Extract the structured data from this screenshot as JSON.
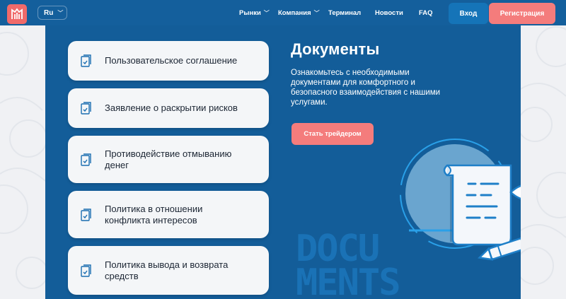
{
  "header": {
    "lang": "Ru",
    "nav": [
      {
        "label": "Рынки",
        "dropdown": true
      },
      {
        "label": "Компания",
        "dropdown": true
      },
      {
        "label": "Терминал",
        "dropdown": false
      },
      {
        "label": "Новости",
        "dropdown": false
      },
      {
        "label": "FAQ",
        "dropdown": false
      }
    ],
    "login": "Вход",
    "register": "Регистрация"
  },
  "documents": [
    {
      "label": "Пользовательское соглашение"
    },
    {
      "label": "Заявление о раскрытии рисков"
    },
    {
      "label": "Противодействие отмыванию денег"
    },
    {
      "label": "Политика в отношении конфликта интересов"
    },
    {
      "label": "Политика вывода и возврата средств"
    }
  ],
  "hero": {
    "title": "Документы",
    "description": "Ознакомьтесь с необходимыми документами для комфортного и безопасного взаимодействия с нашими услугами.",
    "cta": "Стать трейдером",
    "word_top": "DOCU",
    "word_bottom": "MENTS"
  },
  "colors": {
    "header_bg": "#145f9c",
    "panel_bg": "#135d99",
    "accent": "#f47c7c",
    "login_bg": "#1574b8"
  }
}
